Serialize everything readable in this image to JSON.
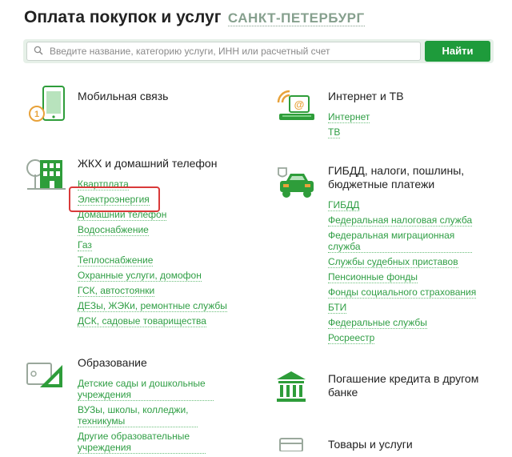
{
  "header": {
    "title": "Оплата покупок и услуг",
    "city": "САНКТ-ПЕТЕРБУРГ"
  },
  "search": {
    "placeholder": "Введите название, категорию услуги, ИНН или расчетный счет",
    "button_label": "Найти"
  },
  "categories": {
    "mobile": {
      "title": "Мобильная связь",
      "icon": "phone-icon"
    },
    "internet": {
      "title": "Интернет и ТВ",
      "icon": "laptop-wifi-icon",
      "links": [
        "Интернет",
        "ТВ"
      ]
    },
    "housing": {
      "title": "ЖКХ и домашний телефон",
      "icon": "building-icon",
      "links": [
        "Квартплата",
        "Электроэнергия",
        "Домашний телефон",
        "Водоснабжение",
        "Газ",
        "Теплоснабжение",
        "Охранные услуги, домофон",
        "ГСК, автостоянки",
        "ДЕЗы, ЖЭКи, ремонтные службы",
        "ДСК, садовые товарищества"
      ]
    },
    "taxes": {
      "title": "ГИБДД, налоги, пошлины, бюджетные платежи",
      "icon": "car-emblem-icon",
      "links": [
        "ГИБДД",
        "Федеральная налоговая служба",
        "Федеральная миграционная служба",
        "Службы судебных приставов",
        "Пенсионные фонды",
        "Фонды социального страхования",
        "БТИ",
        "Федеральные службы",
        "Росреестр"
      ]
    },
    "education": {
      "title": "Образование",
      "icon": "education-icon",
      "links": [
        "Детские сады и дошкольные учреждения",
        "ВУЗы, школы, колледжи, техникумы",
        "Другие образовательные учреждения"
      ]
    },
    "credit": {
      "title": "Погашение кредита в другом банке",
      "icon": "bank-icon"
    },
    "goods": {
      "title": "Товары и услуги",
      "icon": "goods-icon"
    }
  },
  "colors": {
    "accent": "#1e9b3b",
    "link": "#2f9e44",
    "highlight": "#d93a3a",
    "city": "#86a08e"
  }
}
